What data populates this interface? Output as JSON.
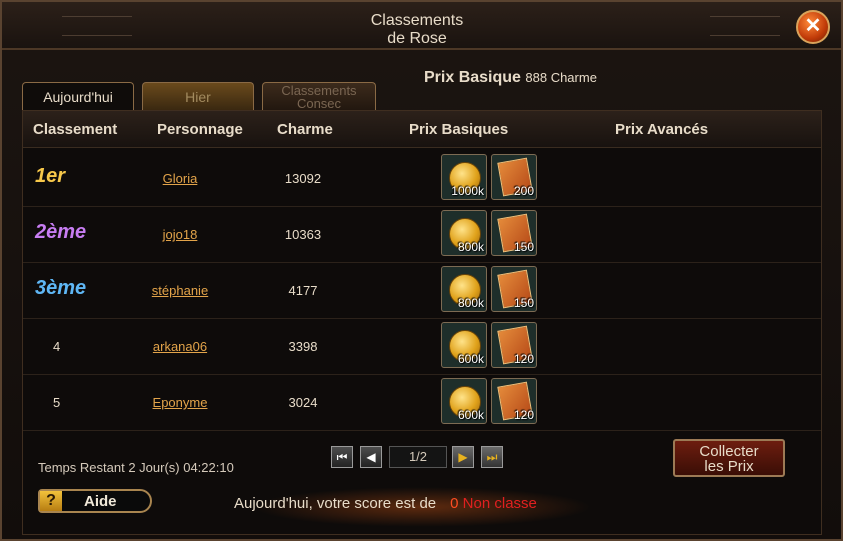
{
  "window": {
    "title_line1": "Classements",
    "title_line2": "de Rose",
    "close_label": "✕"
  },
  "tabs": [
    {
      "label": "Aujourd'hui",
      "active": true
    },
    {
      "label": "Hier",
      "active": false
    },
    {
      "label_line1": "Classements",
      "label_line2": "Consec",
      "active": false
    }
  ],
  "prize_info": {
    "label": "Prix Basique",
    "value": "888 Charme"
  },
  "table": {
    "headers": [
      "Classement",
      "Personnage",
      "Charme",
      "Prix Basiques",
      "Prix Avancés"
    ],
    "rows": [
      {
        "rank": "1er",
        "name": "Gloria",
        "charm": "13092",
        "gold": "1000k",
        "coupons": "200"
      },
      {
        "rank": "2ème",
        "name": "jojo18",
        "charm": "10363",
        "gold": "800k",
        "coupons": "150"
      },
      {
        "rank": "3ème",
        "name": "stéphanie",
        "charm": "4177",
        "gold": "800k",
        "coupons": "150"
      },
      {
        "rank": "4",
        "name": "arkana06",
        "charm": "3398",
        "gold": "600k",
        "coupons": "120"
      },
      {
        "rank": "5",
        "name": "Eponyme",
        "charm": "3024",
        "gold": "600k",
        "coupons": "120"
      }
    ]
  },
  "footer": {
    "time_remaining": "Temps Restant 2 Jour(s)  04:22:10",
    "page_indicator": "1/2",
    "collect_line1": "Collecter",
    "collect_line2": "les Prix",
    "help_icon": "?",
    "help_label": "Aide",
    "score_text": "Aujourd'hui, votre score est de",
    "score_value": "0",
    "score_status": "Non classe"
  },
  "colors": {
    "rank1": "#f7c84a",
    "rank2": "#c77df2",
    "rank3": "#5fb7f5",
    "link": "#e3a44a",
    "accent": "#e02020"
  },
  "icons": {
    "gold_reward": "gold-coin-icon",
    "coupon_reward": "coupon-icon",
    "first": "first-page-icon",
    "prev": "prev-page-icon",
    "next": "next-page-icon",
    "last": "last-page-icon"
  }
}
